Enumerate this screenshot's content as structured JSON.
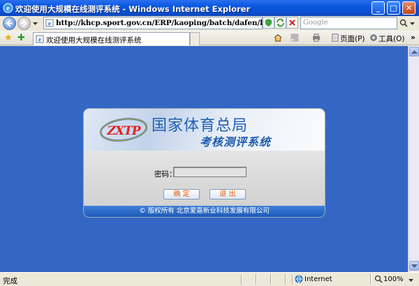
{
  "window": {
    "title": "欢迎使用大规模在线测评系统 - Windows Internet Explorer",
    "minimize": "_",
    "maximize": "□",
    "close": "✕"
  },
  "address": {
    "url": "http://khcp.sport.gov.cn/ERP/kaoping/batch/dafen/login.jsp",
    "search_placeholder": "Google"
  },
  "tab": {
    "label": "欢迎使用大规模在线测评系统"
  },
  "commands": {
    "page": "页面(P)",
    "tools": "工具(O)"
  },
  "login": {
    "logo": "ZXTP",
    "agency": "国家体育总局",
    "system": "考核测评系统",
    "password_label": "密码：",
    "password_value": "",
    "confirm": "确 定",
    "exit": "退 出",
    "copyright": "© 版权所有  北京爱嘉新业科技发展有限公司"
  },
  "status": {
    "text": "完成",
    "zone": "Internet",
    "zoom": "100%"
  },
  "colors": {
    "title_bar": "#0a57de",
    "page_bg": "#3466c4",
    "panel_footer": "#1d5ab8",
    "button_text": "#e06010"
  }
}
